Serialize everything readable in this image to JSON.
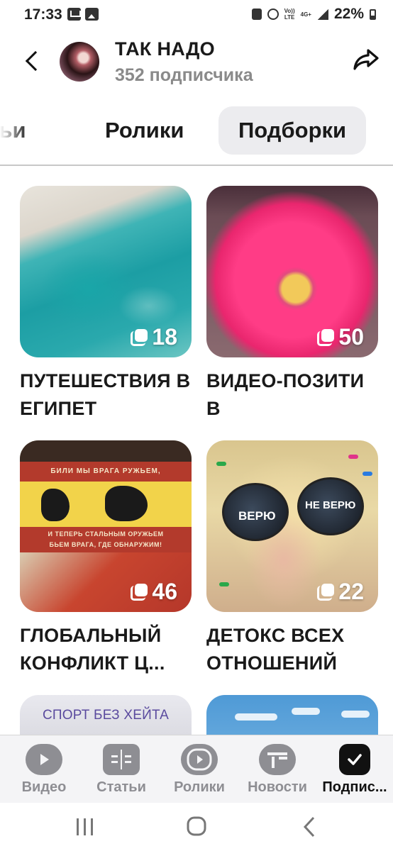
{
  "status_bar": {
    "time": "17:33",
    "network_line1": "Vo))",
    "network_line2": "LTE",
    "network_4g": "4G+",
    "battery": "22%"
  },
  "header": {
    "title": "ТАК НАДО",
    "subtitle": "352 подписчика"
  },
  "tabs": {
    "articles": "Статьи",
    "articles_visible": "атьи",
    "reels": "Ролики",
    "collections": "Подборки",
    "active": "Подборки"
  },
  "collections": [
    {
      "title": "ПУТЕШЕСТВИЯ В ЕГИПЕТ",
      "count": "18"
    },
    {
      "title": "ВИДЕО-ПОЗИТИ В",
      "count": "50"
    },
    {
      "title": "ГЛОБАЛЬНЫЙ КОНФЛИКТ Ц...",
      "count": "46"
    },
    {
      "title": "ДЕТОКС ВСЕХ ОТНОШЕНИЙ",
      "count": "22"
    },
    {
      "image_text": "СПОРТ БЕЗ ХЕЙТА"
    },
    {}
  ],
  "poster_text": {
    "line1": "БИЛИ МЫ ВРАГА РУЖЬЕМ,",
    "line2": "И ТЕПЕРЬ СТАЛЬНЫМ ОРУЖЬЕМ",
    "line3": "БЬЕМ ВРАГА, ГДЕ ОБНАРУЖИМ!"
  },
  "glasses_text": {
    "left": "ВЕРЮ",
    "right": "НЕ ВЕРЮ"
  },
  "bottom_nav": [
    {
      "label": "Видео",
      "icon": "video-icon"
    },
    {
      "label": "Статьи",
      "icon": "articles-icon"
    },
    {
      "label": "Ролики",
      "icon": "reels-icon"
    },
    {
      "label": "Новости",
      "icon": "news-icon"
    },
    {
      "label": "Подпис...",
      "icon": "subscriptions-icon",
      "active": true
    }
  ],
  "colors": {
    "active_tab_bg": "#ececef",
    "nav_inactive": "#8e8e93",
    "nav_active": "#111111",
    "subtitle": "#8a8a8a"
  }
}
